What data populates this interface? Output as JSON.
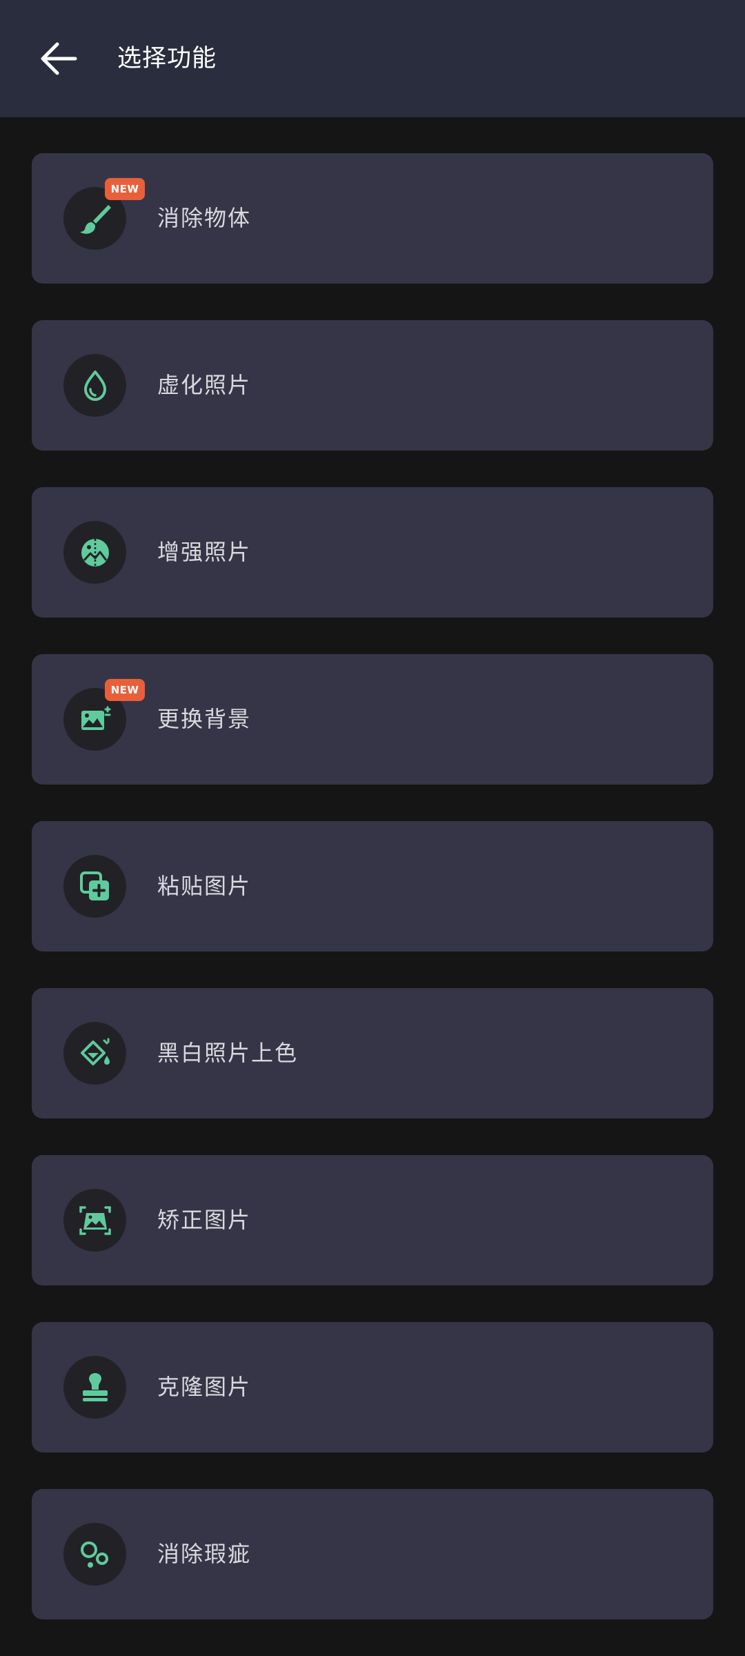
{
  "header": {
    "title": "选择功能",
    "back_icon": "arrow-left-icon"
  },
  "colors": {
    "accent": "#5fcb9d",
    "badge": "#e8603a",
    "card": "#363547",
    "header": "#2a2d3d",
    "background": "#151515"
  },
  "badge_text": "NEW",
  "features": [
    {
      "label": "消除物体",
      "icon": "brush-icon",
      "new": true
    },
    {
      "label": "虚化照片",
      "icon": "droplet-icon",
      "new": false
    },
    {
      "label": "增强照片",
      "icon": "enhance-icon",
      "new": false
    },
    {
      "label": "更换背景",
      "icon": "image-swap-icon",
      "new": true
    },
    {
      "label": "粘贴图片",
      "icon": "paste-add-icon",
      "new": false
    },
    {
      "label": "黑白照片上色",
      "icon": "paint-bucket-icon",
      "new": false
    },
    {
      "label": "矫正图片",
      "icon": "perspective-icon",
      "new": false
    },
    {
      "label": "克隆图片",
      "icon": "stamp-icon",
      "new": false
    },
    {
      "label": "消除瑕疵",
      "icon": "blemish-icon",
      "new": false
    }
  ]
}
